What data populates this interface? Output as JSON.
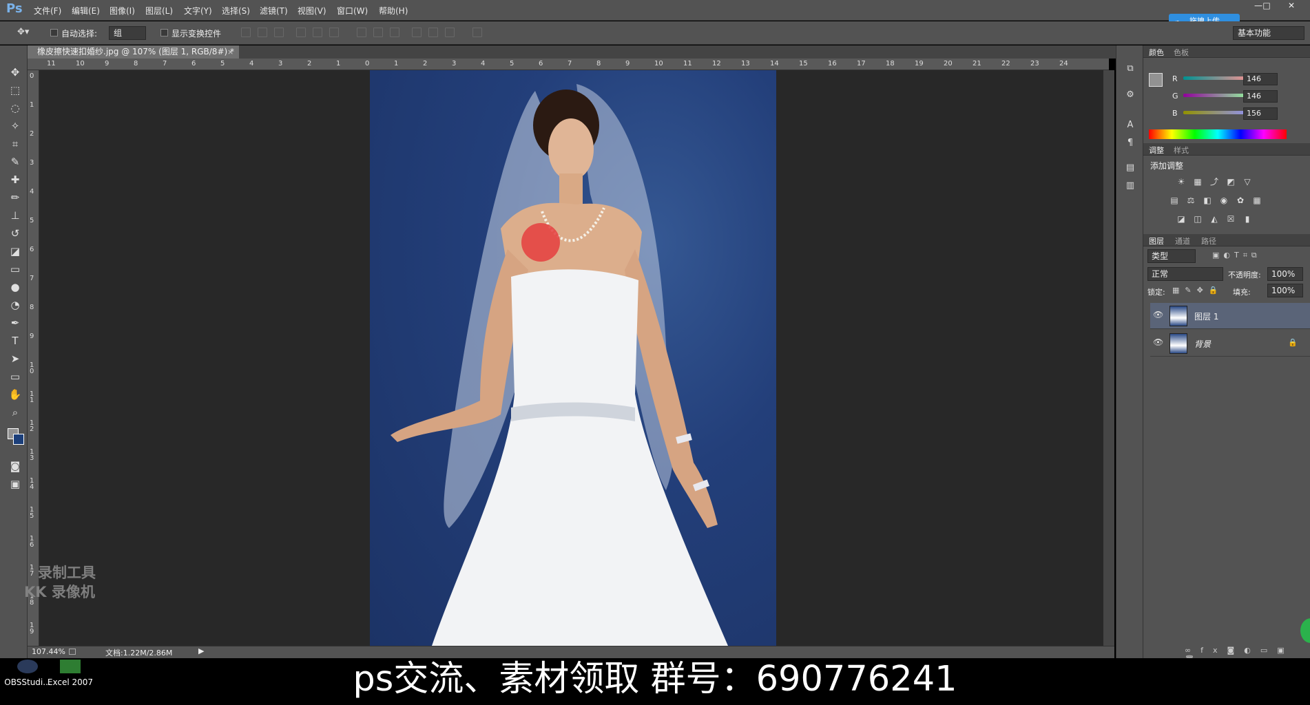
{
  "app": {
    "logo": "Ps"
  },
  "menu": [
    "文件(F)",
    "编辑(E)",
    "图像(I)",
    "图层(L)",
    "文字(Y)",
    "选择(S)",
    "滤镜(T)",
    "视图(V)",
    "窗口(W)",
    "帮助(H)"
  ],
  "window_controls": {
    "minimize": "—",
    "restore": "□",
    "close": "✕"
  },
  "upload_button": "拖拽上传",
  "options": {
    "auto_select_label": "自动选择:",
    "auto_select_value": "组",
    "show_transform_label": "显示变换控件"
  },
  "workspace": "基本功能",
  "document_tab": "橡皮擦快速扣婚纱.jpg @ 107% (图层 1, RGB/8#) *",
  "document_tab_close": "×",
  "hruler_labels": [
    "11",
    "10",
    "9",
    "8",
    "7",
    "6",
    "5",
    "4",
    "3",
    "2",
    "1",
    "0",
    "1",
    "2",
    "3",
    "4",
    "5",
    "6",
    "7",
    "8",
    "9",
    "10",
    "11",
    "12",
    "13",
    "14",
    "15",
    "16",
    "17",
    "18",
    "19",
    "20",
    "21",
    "22",
    "23",
    "24"
  ],
  "vruler_labels": [
    "0",
    "1",
    "2",
    "3",
    "4",
    "5",
    "6",
    "7",
    "8",
    "9",
    "1 0",
    "1 1",
    "1 2",
    "1 3",
    "1 4",
    "1 5",
    "1 6",
    "1 7",
    "1 8",
    "1 9"
  ],
  "status": {
    "zoom": "107.44%",
    "doc": "文档:1.22M/2.86M"
  },
  "panels": {
    "color": {
      "tabs": [
        "颜色",
        "色板"
      ],
      "r_label": "R",
      "g_label": "G",
      "b_label": "B",
      "r": "146",
      "g": "146",
      "b": "156"
    },
    "adjust": {
      "tabs": [
        "调整",
        "样式"
      ],
      "title": "添加调整"
    },
    "layers": {
      "tabs": [
        "图层",
        "通道",
        "路径"
      ],
      "filter": "类型",
      "blend": "正常",
      "opacity_label": "不透明度:",
      "opacity": "100%",
      "lock_label": "锁定:",
      "fill_label": "填充:",
      "fill": "100%",
      "items": [
        {
          "name": "图层 1"
        },
        {
          "name": "背景"
        }
      ]
    }
  },
  "watermark": {
    "line1": "录制工具",
    "line2": "KK 录像机"
  },
  "taskbar": {
    "app1": "OBSStudi...",
    "app2": "Excel 2007"
  },
  "caption": "ps交流、素材领取  群号：690776241",
  "colors": {
    "chrome": "#535353",
    "canvas": "#282828",
    "accent": "#2f8fe0",
    "selection": "#5a6478",
    "brush": "#e53e3e"
  }
}
